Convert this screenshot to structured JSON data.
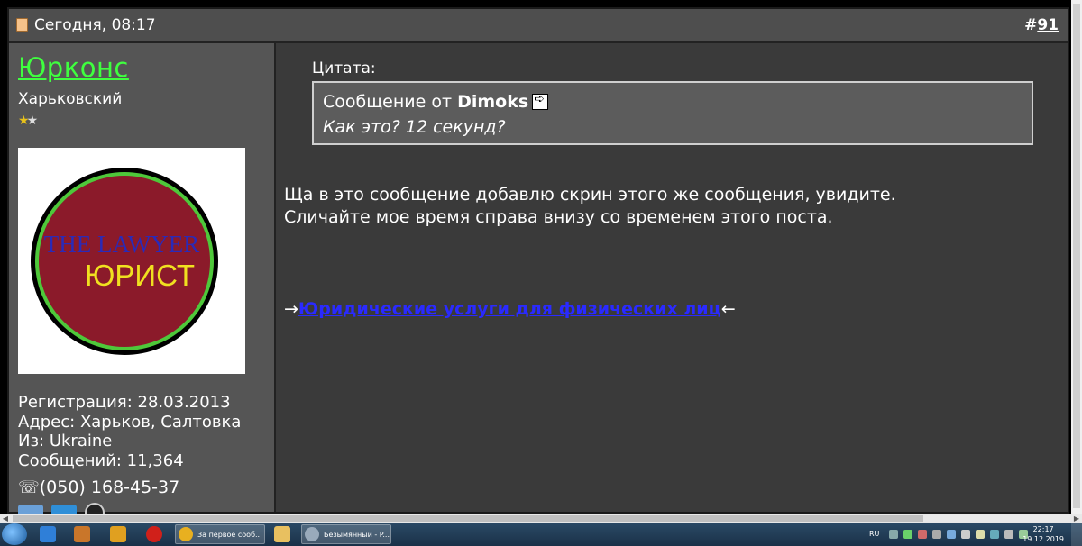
{
  "post": {
    "date": "Сегодня, 08:17",
    "number_prefix": "#",
    "number": "91"
  },
  "user": {
    "name": "Юрконс",
    "title": "Харьковский",
    "stars": "2 of 2",
    "avatar_text_top": "THE LAWYER",
    "avatar_text_bottom": "ЮРИСТ",
    "registration": "Регистрация: 28.03.2013",
    "address": "Адрес: Харьков, Салтовка",
    "from": "Из: Ukraine",
    "messages": "Сообщений: 11,364",
    "phone": "☏(050) 168-45-37"
  },
  "quote": {
    "label": "Цитата:",
    "from_prefix": "Сообщение от ",
    "author": "Dimoks",
    "text": "Как это? 12 секунд?"
  },
  "message": {
    "line1": "Ща в это сообщение добавлю скрин этого же сообщения, увидите.",
    "line2": "Сличайте мое время справа внизу со временем этого поста."
  },
  "signature": {
    "arrow_left": "→",
    "link_text": "Юридические услуги для физических лиц",
    "arrow_right": "←"
  },
  "taskbar": {
    "buttons": [
      {
        "label": "За первое сооб..."
      },
      {
        "label": "Безымянный - P..."
      }
    ],
    "language": "RU",
    "time": "22:17",
    "date": "19.12.2019"
  },
  "colors": {
    "username": "#3fff3f",
    "link": "#2a2aff",
    "avatar_ring": "#8b1a2a"
  }
}
